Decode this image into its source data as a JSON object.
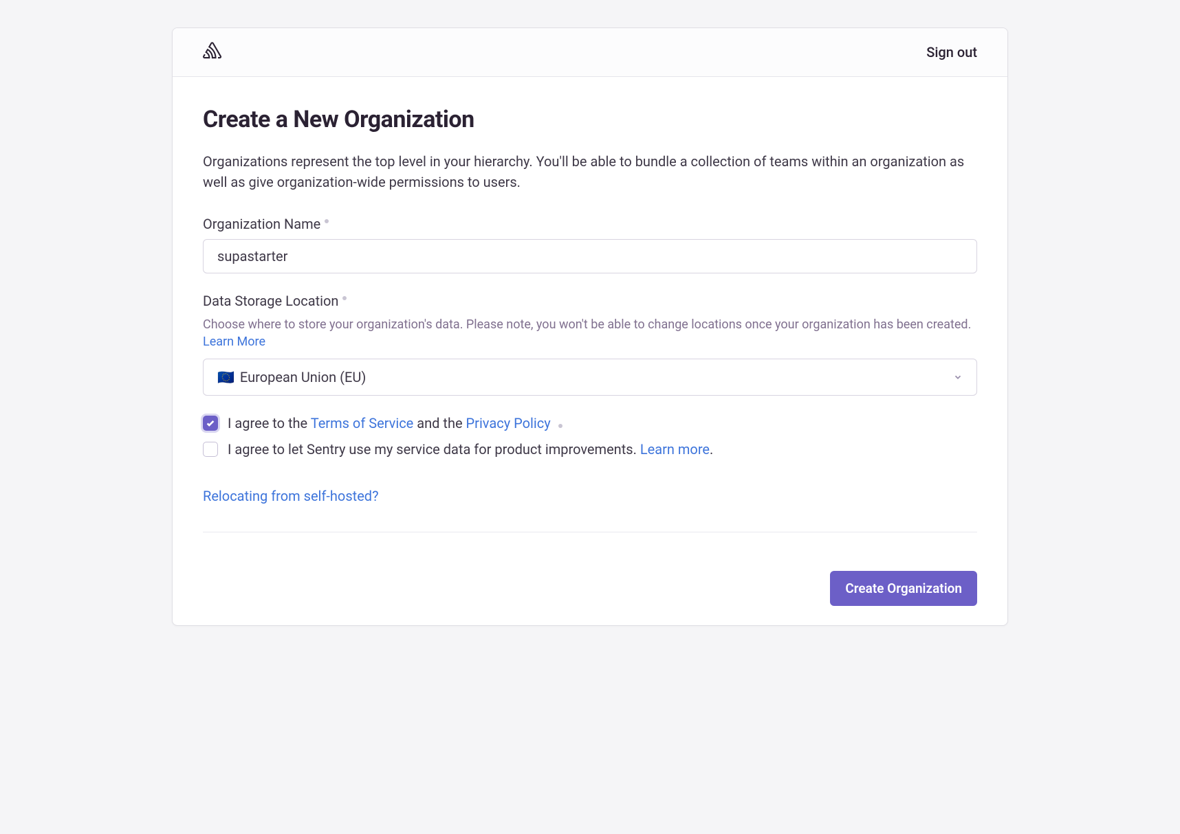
{
  "header": {
    "signout": "Sign out"
  },
  "page": {
    "title": "Create a New Organization",
    "description": "Organizations represent the top level in your hierarchy. You'll be able to bundle a collection of teams within an organization as well as give organization-wide permissions to users."
  },
  "form": {
    "org_name": {
      "label": "Organization Name",
      "value": "supastarter"
    },
    "data_location": {
      "label": "Data Storage Location",
      "help_text": "Choose where to store your organization's data. Please note, you won't be able to change locations once your organization has been created. ",
      "learn_more": "Learn More",
      "selected_flag": "🇪🇺",
      "selected_label": "European Union (EU)"
    },
    "tos": {
      "checked": true,
      "prefix": "I agree to the ",
      "tos_link": "Terms of Service",
      "middle": " and the ",
      "privacy_link": "Privacy Policy"
    },
    "service_data": {
      "checked": false,
      "text": "I agree to let Sentry use my service data for product improvements. ",
      "learn_more": "Learn more",
      "suffix": "."
    },
    "relocating_link": "Relocating from self-hosted?",
    "submit": "Create Organization"
  }
}
